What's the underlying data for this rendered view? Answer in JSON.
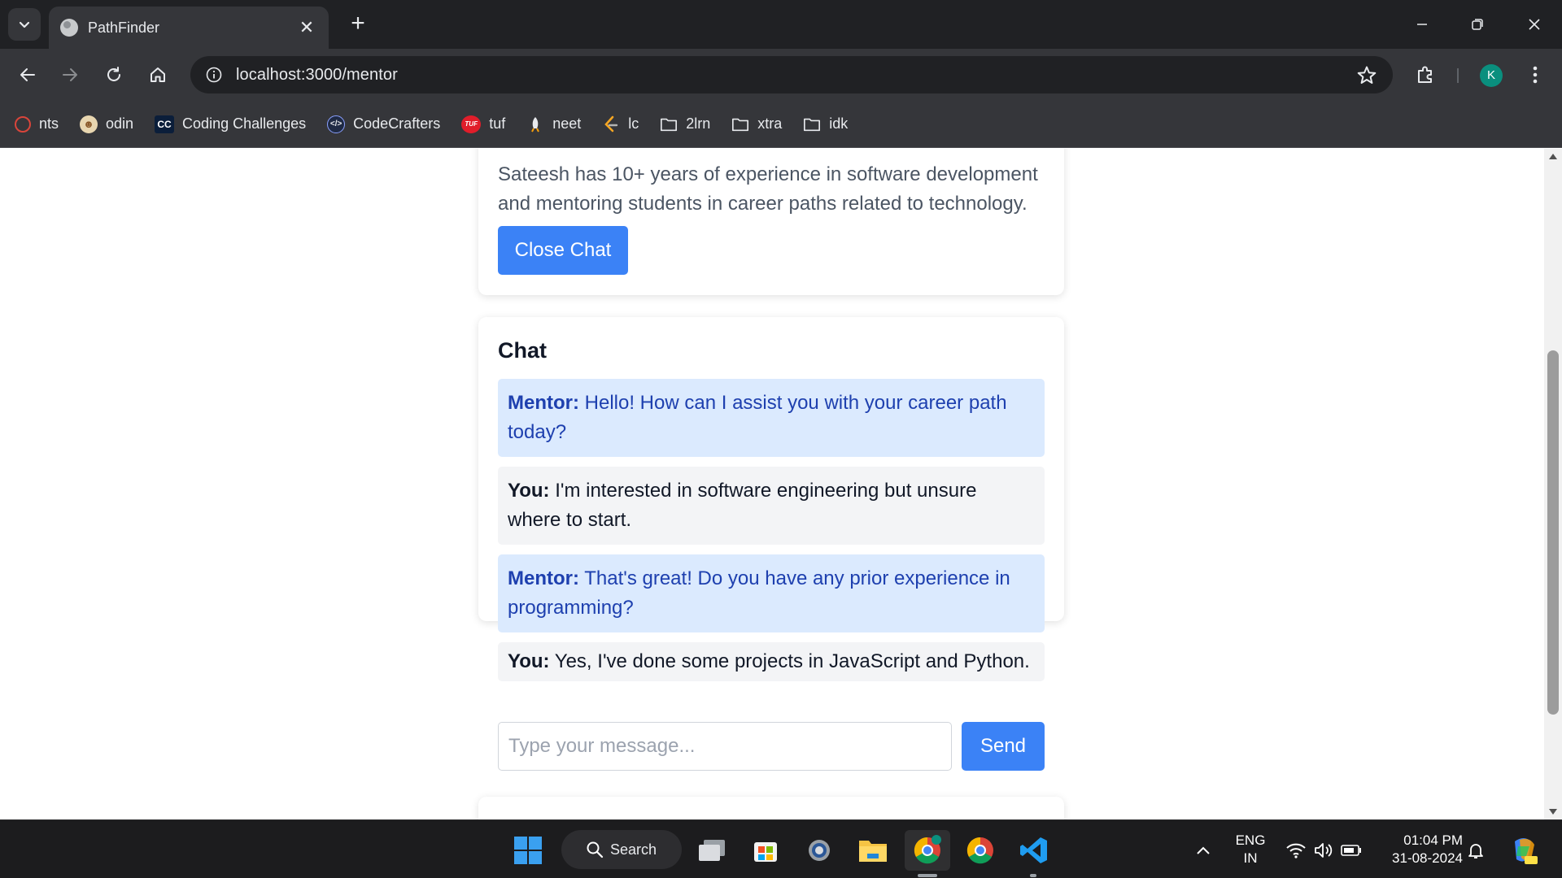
{
  "browser": {
    "tab_title": "PathFinder",
    "tab_close": "✕",
    "new_tab": "+",
    "url": "localhost:3000/mentor",
    "profile_initial": "K"
  },
  "bookmarks": [
    {
      "label": "nts",
      "icon": "nts-icon"
    },
    {
      "label": "odin",
      "icon": "odin-icon"
    },
    {
      "label": "Coding Challenges",
      "icon": "cc-icon"
    },
    {
      "label": "CodeCrafters",
      "icon": "codecrafters-icon"
    },
    {
      "label": "tuf",
      "icon": "tuf-icon"
    },
    {
      "label": "neet",
      "icon": "neet-icon"
    },
    {
      "label": "lc",
      "icon": "leetcode-icon"
    },
    {
      "label": "2lrn",
      "icon": "folder-icon"
    },
    {
      "label": "xtra",
      "icon": "folder-icon"
    },
    {
      "label": "idk",
      "icon": "folder-icon"
    }
  ],
  "mentor_card": {
    "description": "Sateesh has 10+ years of experience in software development and mentoring students in career paths related to technology.",
    "close_button": "Close Chat"
  },
  "chat": {
    "title": "Chat",
    "messages": [
      {
        "sender": "Mentor:",
        "text": "Hello! How can I assist you with your career path today?"
      },
      {
        "sender": "You:",
        "text": "I'm interested in software engineering but unsure where to start."
      },
      {
        "sender": "Mentor:",
        "text": "That's great! Do you have any prior experience in programming?"
      },
      {
        "sender": "You:",
        "text": "Yes, I've done some projects in JavaScript and Python."
      }
    ],
    "input_placeholder": "Type your message...",
    "input_value": "",
    "send_button": "Send"
  },
  "taskbar": {
    "search_label": "Search",
    "language": "ENG",
    "region": "IN",
    "time": "01:04 PM",
    "date": "31-08-2024"
  },
  "colors": {
    "primary_button": "#3b82f6",
    "mentor_bubble": "#dbeafe",
    "mentor_text": "#1e40af",
    "user_bubble": "#f3f4f6",
    "browser_dark": "#202124",
    "browser_toolbar": "#35363a"
  }
}
